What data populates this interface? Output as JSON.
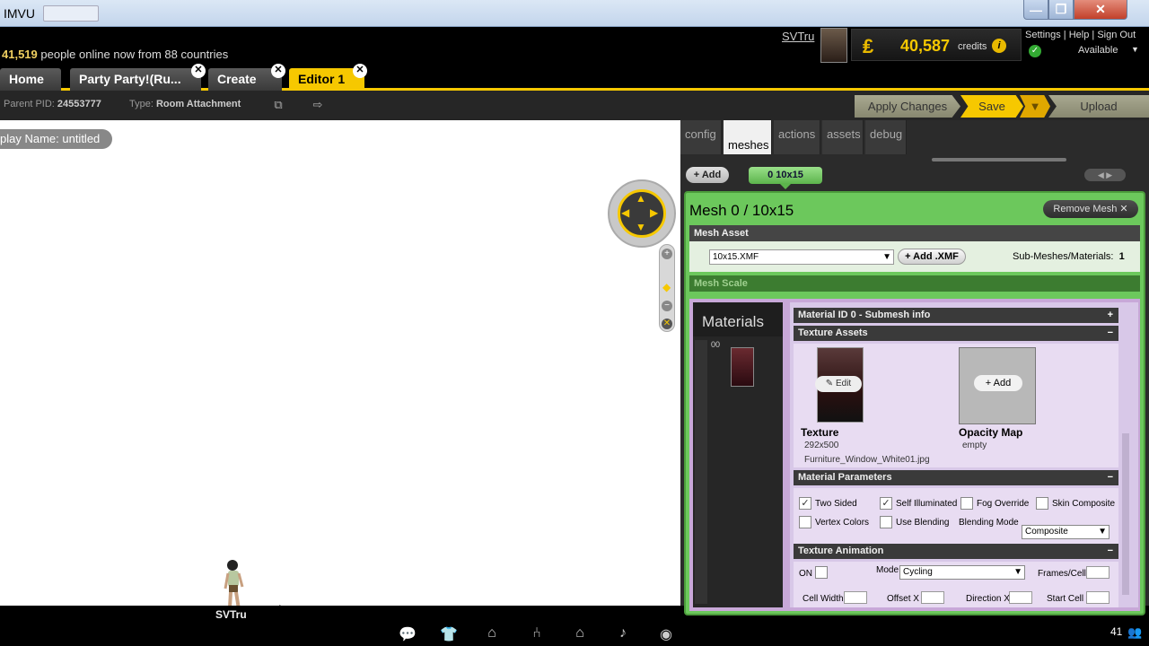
{
  "window": {
    "title": "IMVU",
    "min": "—",
    "max": "❐",
    "close": "✕"
  },
  "topbar": {
    "online_count": "41,519",
    "online_text": " people online now from 88 countries",
    "username": "SVTru",
    "credit_symbol": "₤",
    "credits": "40,587",
    "credits_label": "credits",
    "links": [
      "Settings",
      "Help",
      "Sign Out"
    ],
    "status": "Available"
  },
  "tabs": [
    {
      "label": "Home"
    },
    {
      "label": "Party Party!(Ru..."
    },
    {
      "label": "Create"
    },
    {
      "label": "Editor 1"
    }
  ],
  "toolbar": {
    "parent_pid_label": "Parent PID:",
    "parent_pid": "24553777",
    "type_label": "Type:",
    "type": "Room Attachment",
    "apply": "Apply Changes",
    "save": "Save",
    "upload": "Upload"
  },
  "viewport": {
    "display_name": "play Name: untitled"
  },
  "statusbar": {
    "name": "SVTru",
    "count": "41"
  },
  "panel": {
    "tabs": [
      "config",
      "meshes",
      "actions",
      "assets",
      "debug"
    ],
    "add": "Add",
    "mesh_tab": "0 10x15",
    "mesh_title": "Mesh 0 / 10x15",
    "remove_mesh": "Remove Mesh",
    "mesh_asset": "Mesh Asset",
    "xmf_value": "10x15.XMF",
    "add_xmf": "Add .XMF",
    "submeshes_label": "Sub-Meshes/Materials:",
    "submeshes_count": "1",
    "mesh_scale": "Mesh Scale",
    "materials_title": "Materials",
    "material_thumb_label": "00",
    "material_id": "Material ID 0 - Submesh info",
    "texture_assets": "Texture Assets",
    "edit": "Edit",
    "texture_label": "Texture",
    "texture_size": "292x500",
    "texture_file": "Furniture_Window_White01.jpg",
    "opacity_add": "Add",
    "opacity_label": "Opacity Map",
    "opacity_value": "empty",
    "material_params": "Material Parameters",
    "params": {
      "two_sided": "Two Sided",
      "self_illuminated": "Self Illuminated",
      "fog_override": "Fog Override",
      "skin_composite": "Skin Composite",
      "vertex_colors": "Vertex Colors",
      "use_blending": "Use Blending",
      "blending_mode": "Blending Mode",
      "blending_value": "Composite"
    },
    "texture_animation": "Texture Animation",
    "anim": {
      "on": "ON",
      "mode": "Mode",
      "mode_value": "Cycling",
      "frames_cell": "Frames/Cell",
      "cell_width": "Cell Width",
      "offset_x": "Offset X",
      "direction_x": "Direction X",
      "start_cell": "Start Cell"
    }
  },
  "colors": {
    "accent": "#f6c800",
    "mesh_green": "#6cc85c",
    "materials_purple": "#c8a8d8"
  }
}
